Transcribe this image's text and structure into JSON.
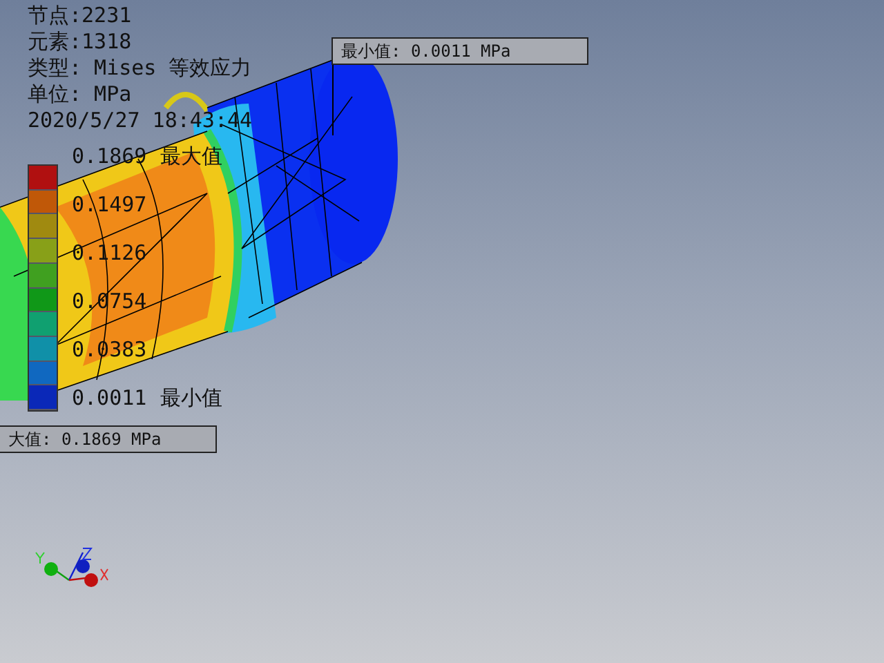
{
  "info_lines": [
    "节点:2231",
    "元素:1318",
    "类型: Mises 等效应力",
    "单位: MPa",
    "2020/5/27 18:43:44"
  ],
  "legend": {
    "bands": [
      {
        "color": "#b01010"
      },
      {
        "color": "#c05808"
      },
      {
        "color": "#a08a10"
      },
      {
        "color": "#88a018"
      },
      {
        "color": "#40a020"
      },
      {
        "color": "#109818"
      },
      {
        "color": "#10a070"
      },
      {
        "color": "#1090a8"
      },
      {
        "color": "#1068c0"
      },
      {
        "color": "#0a28b8"
      }
    ],
    "labels": [
      {
        "value": "0.1869",
        "tag": "最大值"
      },
      {
        "value": "0.1497"
      },
      {
        "value": "0.1126"
      },
      {
        "value": "0.0754"
      },
      {
        "value": "0.0383"
      },
      {
        "value": "0.0011",
        "tag": "最小值"
      }
    ]
  },
  "callouts": [
    {
      "kind": "min",
      "text": "最小值: 0.0011 MPa"
    },
    {
      "kind": "max",
      "text": "大值: 0.1869 MPa"
    }
  ]
}
